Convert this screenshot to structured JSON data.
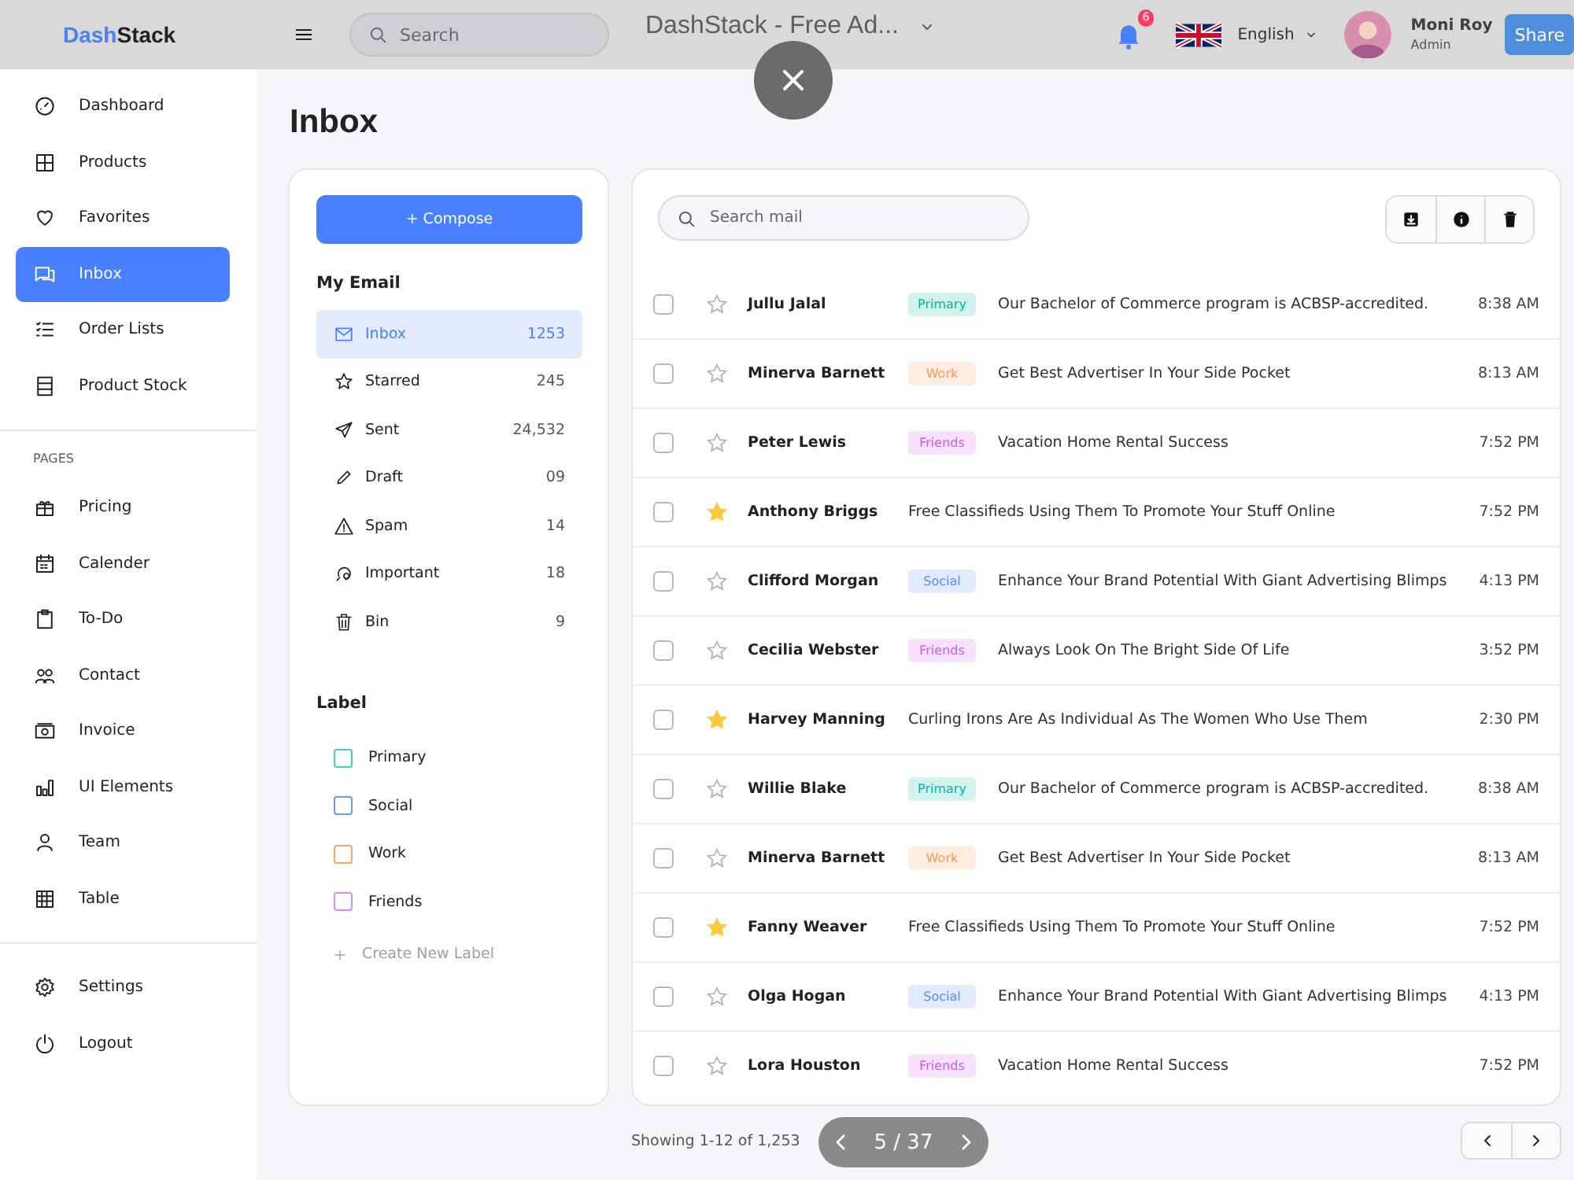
{
  "header": {
    "logo": {
      "accent": "Dash",
      "rest": "Stack"
    },
    "search": {
      "placeholder": "Search"
    },
    "notification_count": "6",
    "language": "English",
    "user": {
      "name": "Moni Roy",
      "role": "Admin"
    }
  },
  "viewer": {
    "title": "DashStack - Free Ad...",
    "share": "Share",
    "counter": "5 / 37"
  },
  "sidebar": {
    "items": [
      {
        "label": "Dashboard",
        "selected": false
      },
      {
        "label": "Products",
        "selected": false
      },
      {
        "label": "Favorites",
        "selected": false
      },
      {
        "label": "Inbox",
        "selected": true
      },
      {
        "label": "Order Lists",
        "selected": false
      },
      {
        "label": "Product Stock",
        "selected": false
      }
    ],
    "pages_heading": "PAGES",
    "pages": [
      {
        "label": "Pricing",
        "selected": false
      },
      {
        "label": "Calender",
        "selected": false
      },
      {
        "label": "To-Do",
        "selected": false
      },
      {
        "label": "Contact",
        "selected": false
      },
      {
        "label": "Invoice",
        "selected": false
      },
      {
        "label": "UI Elements",
        "selected": false
      },
      {
        "label": "Team",
        "selected": false
      },
      {
        "label": "Table",
        "selected": false
      }
    ],
    "bottom": [
      {
        "label": "Settings",
        "selected": false
      },
      {
        "label": "Logout",
        "selected": false
      }
    ]
  },
  "page_title": "Inbox",
  "mail_nav": {
    "compose": "+ Compose",
    "heading": "My Email",
    "folders": [
      {
        "label": "Inbox",
        "count": "1253",
        "selected": true
      },
      {
        "label": "Starred",
        "count": "245",
        "selected": false
      },
      {
        "label": "Sent",
        "count": "24,532",
        "selected": false
      },
      {
        "label": "Draft",
        "count": "09",
        "selected": false
      },
      {
        "label": "Spam",
        "count": "14",
        "selected": false
      },
      {
        "label": "Important",
        "count": "18",
        "selected": false
      },
      {
        "label": "Bin",
        "count": "9",
        "selected": false
      }
    ],
    "label_heading": "Label",
    "labels": [
      {
        "label": "Primary",
        "color": "#41d1b3",
        "checked": false
      },
      {
        "label": "Social",
        "color": "#6f97ef",
        "checked": false
      },
      {
        "label": "Work",
        "color": "#f5a56b",
        "checked": false
      },
      {
        "label": "Friends",
        "color": "#d98cf0",
        "checked": false
      }
    ],
    "create_label": "Create New Label"
  },
  "mail_list": {
    "search": {
      "placeholder": "Search mail"
    },
    "rows": [
      {
        "sender": "Jullu Jalal",
        "tag": {
          "label": "Primary",
          "color": "#00b69b"
        },
        "subject": "Our Bachelor of Commerce program is ACBSP-accredited.",
        "time": "8:38 AM",
        "starred": false,
        "checked": false
      },
      {
        "sender": "Minerva Barnett",
        "tag": {
          "label": "Work",
          "color": "#fd9a56"
        },
        "subject": "Get Best Advertiser In Your Side Pocket",
        "time": "8:13 AM",
        "starred": false,
        "checked": false
      },
      {
        "sender": "Peter Lewis",
        "tag": {
          "label": "Friends",
          "color": "#d456fd"
        },
        "subject": "Vacation Home Rental Success",
        "time": "7:52 PM",
        "starred": false,
        "checked": false
      },
      {
        "sender": "Anthony Briggs",
        "subject": "Free Classifieds Using Them To Promote Your Stuff Online",
        "time": "7:52 PM",
        "starred": true,
        "checked": false
      },
      {
        "sender": "Clifford Morgan",
        "tag": {
          "label": "Social",
          "color": "#5a8cff"
        },
        "subject": "Enhance Your Brand Potential With Giant Advertising Blimps",
        "time": "4:13 PM",
        "starred": false,
        "checked": false
      },
      {
        "sender": "Cecilia Webster",
        "tag": {
          "label": "Friends",
          "color": "#d456fd"
        },
        "subject": "Always Look On The Bright Side Of Life",
        "time": "3:52 PM",
        "starred": false,
        "checked": false
      },
      {
        "sender": "Harvey Manning",
        "subject": "Curling Irons Are As Individual As The Women Who Use Them",
        "time": "2:30 PM",
        "starred": true,
        "checked": false
      },
      {
        "sender": "Willie Blake",
        "tag": {
          "label": "Primary",
          "color": "#00b69b"
        },
        "subject": "Our Bachelor of Commerce program is ACBSP-accredited.",
        "time": "8:38 AM",
        "starred": false,
        "checked": false
      },
      {
        "sender": "Minerva Barnett",
        "tag": {
          "label": "Work",
          "color": "#fd9a56"
        },
        "subject": "Get Best Advertiser In Your Side Pocket",
        "time": "8:13 AM",
        "starred": false,
        "checked": false
      },
      {
        "sender": "Fanny Weaver",
        "subject": "Free Classifieds Using Them To Promote Your Stuff Online",
        "time": "7:52 PM",
        "starred": true,
        "checked": false
      },
      {
        "sender": "Olga Hogan",
        "tag": {
          "label": "Social",
          "color": "#5a8cff"
        },
        "subject": "Enhance Your Brand Potential With Giant Advertising Blimps",
        "time": "4:13 PM",
        "starred": false,
        "checked": false
      },
      {
        "sender": "Lora Houston",
        "tag": {
          "label": "Friends",
          "color": "#d456fd"
        },
        "subject": "Vacation Home Rental Success",
        "time": "7:52 PM",
        "starred": false,
        "checked": false
      }
    ],
    "showing": "Showing 1-12 of 1,253"
  }
}
